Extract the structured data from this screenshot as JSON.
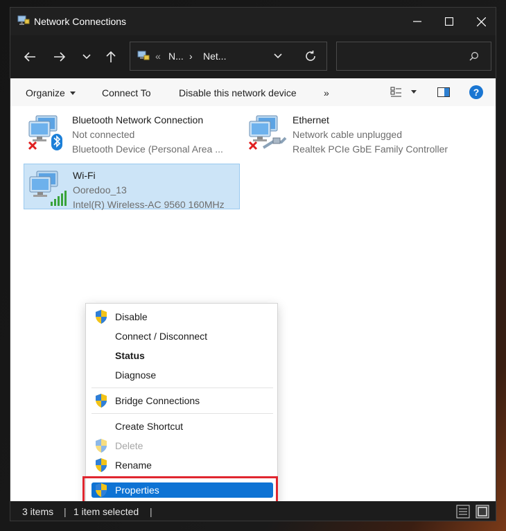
{
  "window": {
    "title": "Network Connections"
  },
  "titlebar": {
    "minimize_icon": "minimize-icon",
    "maximize_icon": "maximize-icon",
    "close_icon": "close-icon"
  },
  "address": {
    "overflow": "«",
    "crumb1": "N...",
    "separator": "›",
    "crumb2": "Net...",
    "search_placeholder": ""
  },
  "commands": {
    "organize": "Organize",
    "connect_to": "Connect To",
    "disable_device": "Disable this network device",
    "more": "»"
  },
  "items": [
    {
      "name": "Bluetooth Network Connection",
      "status": "Not connected",
      "device": "Bluetooth Device (Personal Area ...",
      "icon": "bluetooth-network-icon"
    },
    {
      "name": "Ethernet",
      "status": "Network cable unplugged",
      "device": "Realtek PCIe GbE Family Controller",
      "icon": "ethernet-network-icon"
    },
    {
      "name": "Wi-Fi",
      "status": "Ooredoo_13",
      "device": "Intel(R) Wireless-AC 9560 160MHz",
      "icon": "wifi-network-icon",
      "selected": true
    }
  ],
  "context_menu": {
    "disable": "Disable",
    "connect_disconnect": "Connect / Disconnect",
    "status": "Status",
    "diagnose": "Diagnose",
    "bridge": "Bridge Connections",
    "create_shortcut": "Create Shortcut",
    "delete": "Delete",
    "rename": "Rename",
    "properties": "Properties"
  },
  "statusbar": {
    "count": "3 items",
    "separator": "|",
    "selected": "1 item selected"
  },
  "colors": {
    "accent": "#0e73d4",
    "highlight_box": "#e0262f",
    "selection_bg": "#cce4f7"
  }
}
